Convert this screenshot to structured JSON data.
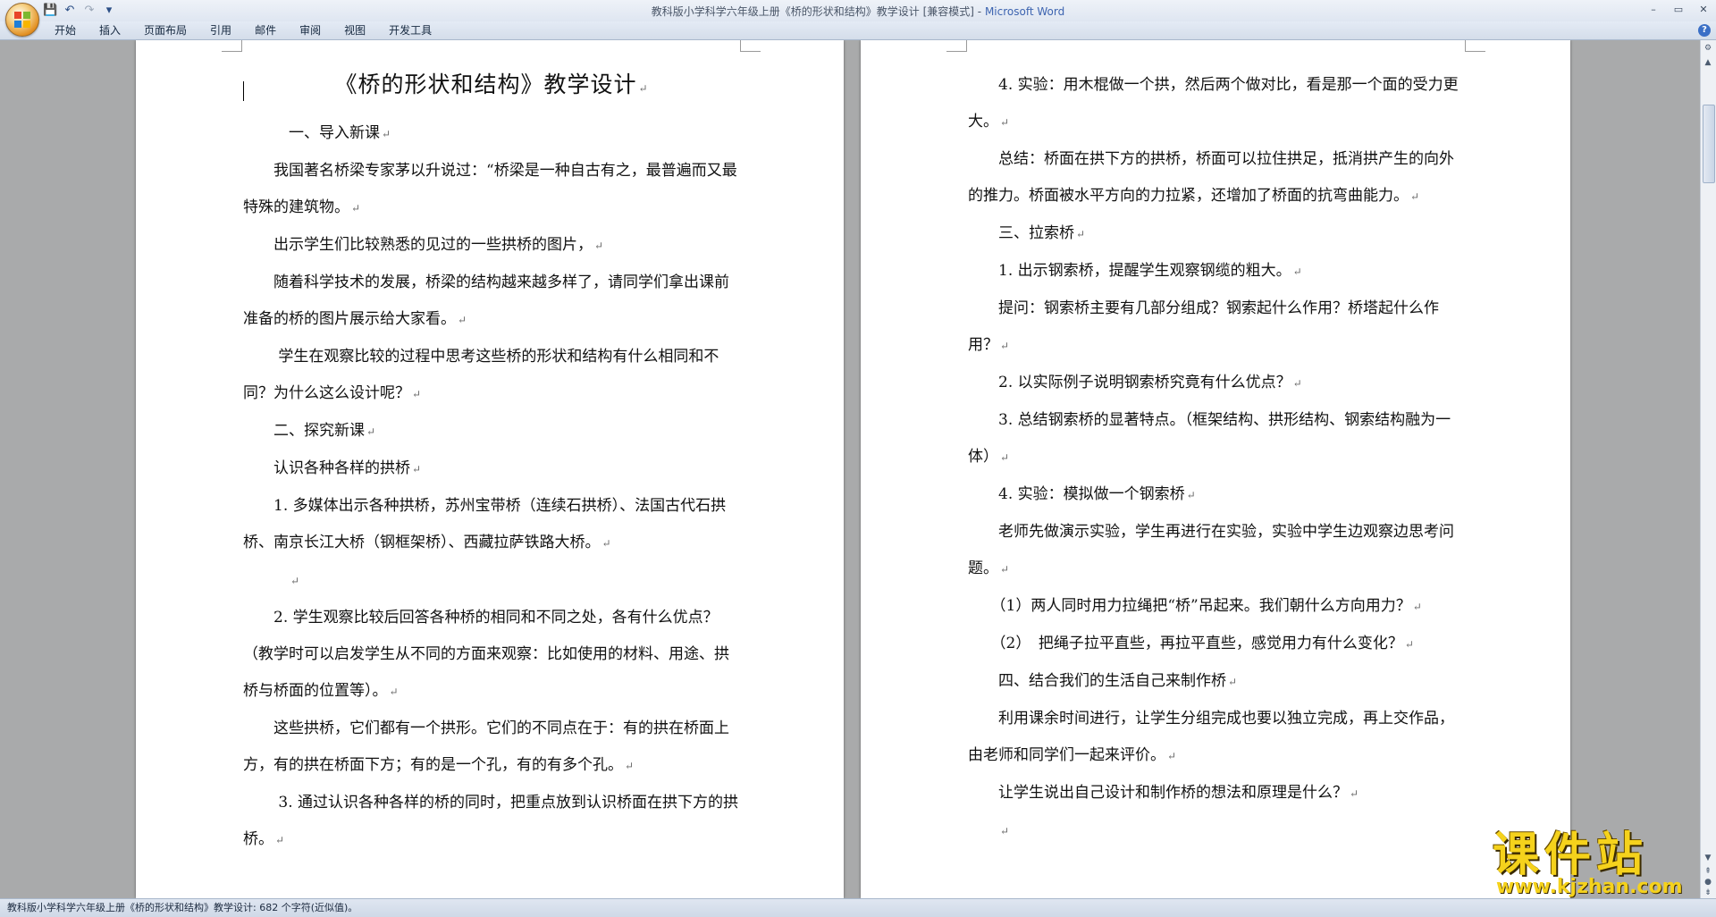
{
  "window": {
    "doc_name": "教科版小学科学六年级上册《桥的形状和结构》教学设计 [兼容模式]",
    "separator": " - ",
    "app_name": "Microsoft Word",
    "controls": {
      "minimize": "–",
      "maximize": "▭",
      "close": "✕"
    }
  },
  "quick_access": {
    "save": "💾",
    "undo": "↶",
    "redo": "↷",
    "customize": "▾"
  },
  "ribbon": {
    "tabs": [
      "开始",
      "插入",
      "页面布局",
      "引用",
      "邮件",
      "审阅",
      "视图",
      "开发工具"
    ],
    "help": "?"
  },
  "page1": {
    "title": "《桥的形状和结构》教学设计",
    "paragraphs": [
      "　　　一、导入新课",
      "　　我国著名桥梁专家茅以升说过：“桥梁是一种自古有之，最普遍而又最特殊的建筑物。",
      "　　出示学生们比较熟悉的见过的一些拱桥的图片，",
      "　　随着科学技术的发展，桥梁的结构越来越多样了，请同学们拿出课前准备的桥的图片展示给大家看。",
      "　　 学生在观察比较的过程中思考这些桥的形状和结构有什么相同和不同？为什么这么设计呢？",
      "　　二、探究新课",
      "　　认识各种各样的拱桥",
      "　　1. 多媒体出示各种拱桥，苏州宝带桥（连续石拱桥）、法国古代石拱桥、南京长江大桥（钢框架桥）、西藏拉萨铁路大桥。",
      "　　　",
      "　　2. 学生观察比较后回答各种桥的相同和不同之处，各有什么优点？（教学时可以启发学生从不同的方面来观察：比如使用的材料、用途、拱桥与桥面的位置等）。",
      "　　这些拱桥，它们都有一个拱形。它们的不同点在于：有的拱在桥面上方，有的拱在桥面下方；有的是一个孔，有的有多个孔。",
      "　　 3. 通过认识各种各样的桥的同时，把重点放到认识桥面在拱下方的拱桥。"
    ]
  },
  "page2": {
    "paragraphs": [
      "　　4. 实验：用木棍做一个拱，然后两个做对比，看是那一个面的受力更大。",
      "　　总结：桥面在拱下方的拱桥，桥面可以拉住拱足，抵消拱产生的向外的推力。桥面被水平方向的力拉紧，还增加了桥面的抗弯曲能力。",
      "　　三、拉索桥",
      "　　1. 出示钢索桥，提醒学生观察钢缆的粗大。",
      "　　提问：钢索桥主要有几部分组成？钢索起什么作用？桥塔起什么作用？",
      "　　2. 以实际例子说明钢索桥究竟有什么优点？",
      "　　3. 总结钢索桥的显著特点。（框架结构、拱形结构、钢索结构融为一体）",
      "　　4. 实验：模拟做一个钢索桥",
      "　　老师先做演示实验，学生再进行在实验，实验中学生边观察边思考问题。",
      "　　（1）两人同时用力拉绳把“桥”吊起来。我们朝什么方向用力？",
      "　　（2）　把绳子拉平直些，再拉平直些，感觉用力有什么变化？",
      "　　四、结合我们的生活自己来制作桥",
      "　　利用课余时间进行，让学生分组完成也要以独立完成，再上交作品，由老师和同学们一起来评价。",
      "　　让学生说出自己设计和制作桥的想法和原理是什么？",
      "　　"
    ]
  },
  "status": {
    "text": "教科版小学科学六年级上册《桥的形状和结构》教学设计: 682 个字符(近似值)。"
  },
  "watermark": {
    "main": "课件站",
    "url": "www.kjzhan.com"
  },
  "paragraph_mark": "↵"
}
